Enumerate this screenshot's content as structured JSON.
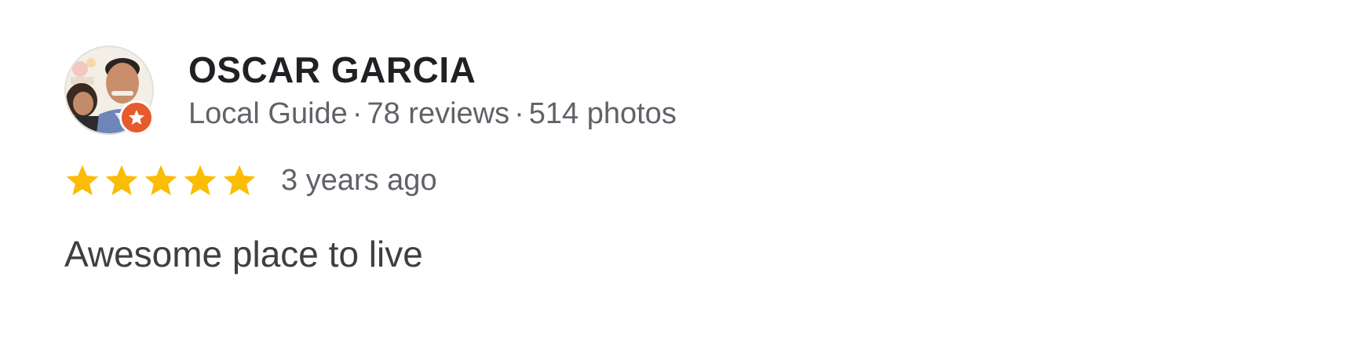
{
  "review": {
    "author": {
      "name": "OSCAR GARCIA",
      "badge": "Local Guide",
      "reviews": "78 reviews",
      "photos": "514 photos",
      "separator": "·",
      "avatar_icon": "user-avatar-photo",
      "badge_icon": "local-guide-star-badge"
    },
    "rating": {
      "stars": 5,
      "max_stars": 5,
      "star_color": "#fbbc04"
    },
    "date": "3 years ago",
    "text": "Awesome place to live"
  },
  "colors": {
    "name": "#202124",
    "meta": "#5f6368",
    "body_text": "#3c4043",
    "badge": "#e8592b"
  }
}
